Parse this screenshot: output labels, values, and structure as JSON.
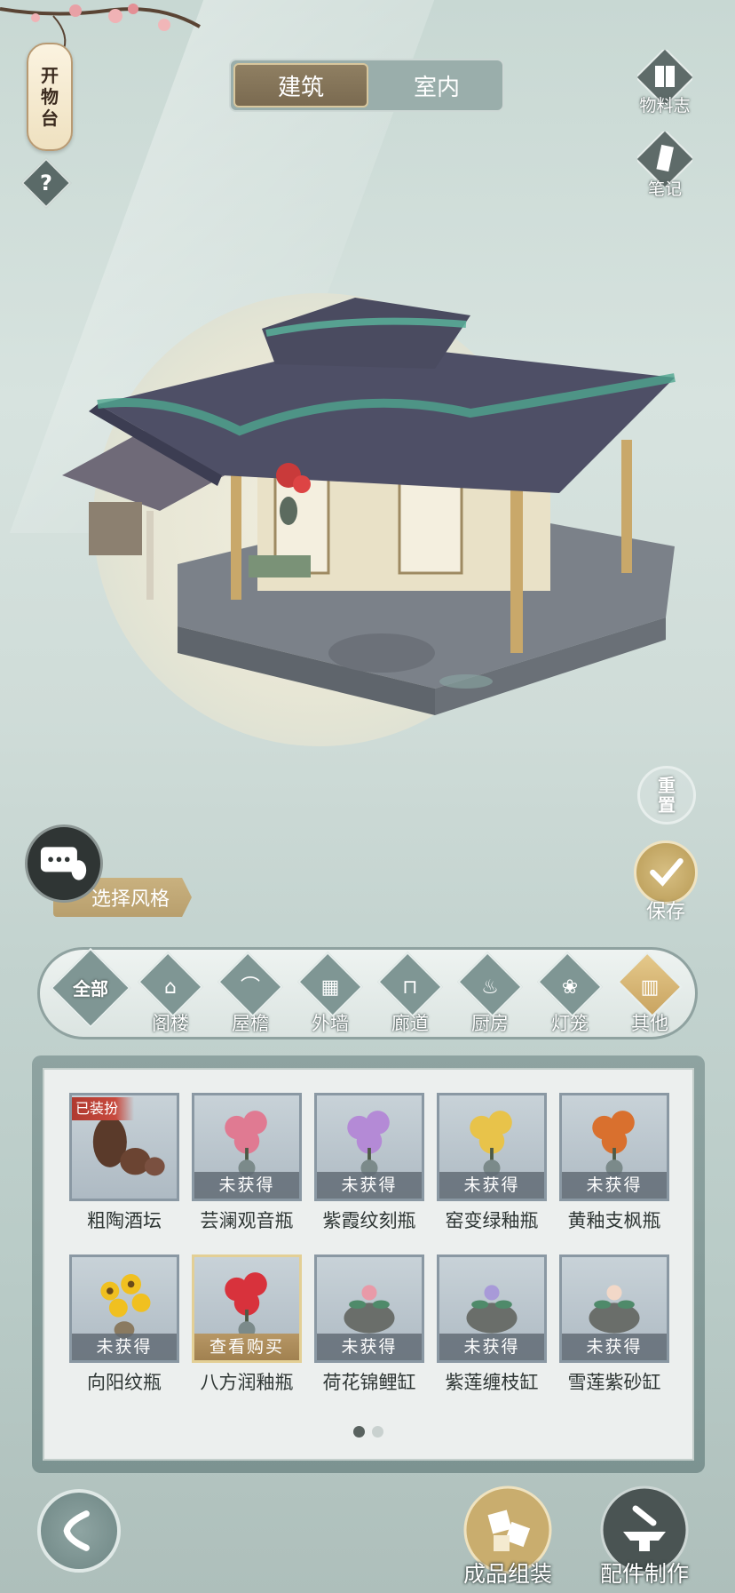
{
  "lantern": {
    "chars": [
      "开",
      "物",
      "台"
    ]
  },
  "help": {
    "label": "?"
  },
  "tabs": [
    {
      "label": "建筑",
      "active": true
    },
    {
      "label": "室内",
      "active": false
    }
  ],
  "right_menu": {
    "catalog_label": "物料志",
    "notes_label": "笔记"
  },
  "side": {
    "reset_chars": [
      "重",
      "置"
    ],
    "save_label": "保存",
    "style_label": "选择风格"
  },
  "categories": [
    {
      "label": "全部",
      "icon": "all-icon"
    },
    {
      "label": "阁楼",
      "icon": "pavilion-icon"
    },
    {
      "label": "屋檐",
      "icon": "eaves-icon"
    },
    {
      "label": "外墙",
      "icon": "wall-icon"
    },
    {
      "label": "廊道",
      "icon": "corridor-icon"
    },
    {
      "label": "厨房",
      "icon": "kitchen-icon"
    },
    {
      "label": "灯笼",
      "icon": "lantern-icon"
    },
    {
      "label": "其他",
      "icon": "screen-icon",
      "active": true
    }
  ],
  "items": [
    {
      "name": "粗陶酒坛",
      "status": "",
      "badge": "已装扮",
      "plant": "jar",
      "color": "#5a3a2a"
    },
    {
      "name": "芸澜观音瓶",
      "status": "未获得",
      "plant": "flower",
      "color": "#e07a92"
    },
    {
      "name": "紫霞纹刻瓶",
      "status": "未获得",
      "plant": "flower",
      "color": "#b48ad6"
    },
    {
      "name": "窑变绿釉瓶",
      "status": "未获得",
      "plant": "flower",
      "color": "#e8c34a"
    },
    {
      "name": "黄釉支枫瓶",
      "status": "未获得",
      "plant": "flower",
      "color": "#d9702e"
    },
    {
      "name": "向阳纹瓶",
      "status": "未获得",
      "plant": "sunflower",
      "color": "#f0c020"
    },
    {
      "name": "八方润釉瓶",
      "status": "查看购买",
      "plant": "flower",
      "color": "#d8323c",
      "selected": true
    },
    {
      "name": "荷花锦鲤缸",
      "status": "未获得",
      "plant": "bowl",
      "color": "#e89aa8"
    },
    {
      "name": "紫莲缠枝缸",
      "status": "未获得",
      "plant": "bowl",
      "color": "#a89ad8"
    },
    {
      "name": "雪莲紫砂缸",
      "status": "未获得",
      "plant": "bowl",
      "color": "#f2d8c8"
    }
  ],
  "pagination": {
    "pages": 2,
    "current": 1
  },
  "bottom": {
    "assemble_label": "成品组装",
    "craft_label": "配件制作"
  }
}
